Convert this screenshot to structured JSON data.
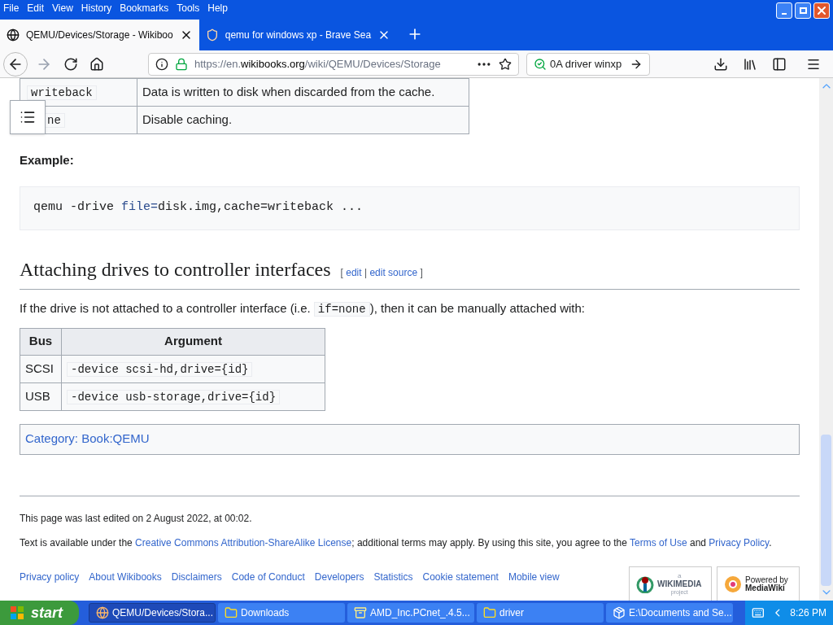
{
  "menu": [
    "File",
    "Edit",
    "View",
    "History",
    "Bookmarks",
    "Tools",
    "Help"
  ],
  "tabs": [
    {
      "label": "QEMU/Devices/Storage - Wikiboo",
      "selected": true
    },
    {
      "label": "qemu for windows xp - Brave Sea",
      "selected": false
    }
  ],
  "address": {
    "prefix": "https://en.",
    "domain": "wikibooks.org",
    "path": "/wiki/QEMU/Devices/Storage"
  },
  "search": {
    "value": "0A driver winxp"
  },
  "cache_table": {
    "rows": [
      {
        "mode": "writeback",
        "description": "Data is written to disk when discarded from the cache."
      },
      {
        "mode": "ne",
        "description": "Disable caching."
      }
    ]
  },
  "example_label": "Example:",
  "code_block": [
    {
      "text": "qemu -drive ",
      "kind": "plain"
    },
    {
      "text": "file=",
      "kind": "keyword"
    },
    {
      "text": "disk.img,cache=writeback ...",
      "kind": "plain"
    }
  ],
  "heading": {
    "title": "Attaching drives to controller interfaces",
    "open": "[",
    "links": [
      "edit",
      "edit source"
    ],
    "separator": "|",
    "close": "]"
  },
  "intro": [
    {
      "text": "If the drive is not attached to a controller interface (i.e. ",
      "kind": "text"
    },
    {
      "text": "if=none",
      "kind": "code"
    },
    {
      "text": "), then it can be manually attached with:",
      "kind": "text"
    }
  ],
  "bus_table": {
    "columns": [
      "Bus",
      "Argument"
    ],
    "rows": [
      {
        "bus": "SCSI",
        "argument": "-device scsi-hd,drive={id}"
      },
      {
        "bus": "USB",
        "argument": "-device usb-storage,drive={id}"
      }
    ]
  },
  "category": "Category: Book:QEMU",
  "footer": {
    "last_edited": "This page was last edited on 2 August 2022, at 00:02.",
    "license": [
      {
        "text": "Text is available under the ",
        "kind": "text"
      },
      {
        "text": "Creative Commons Attribution-ShareAlike License",
        "kind": "link"
      },
      {
        "text": "; additional terms may apply. By using this site, you agree to the ",
        "kind": "text"
      },
      {
        "text": "Terms of Use",
        "kind": "link"
      },
      {
        "text": " and ",
        "kind": "text"
      },
      {
        "text": "Privacy Policy",
        "kind": "link"
      },
      {
        "text": ".",
        "kind": "text"
      }
    ],
    "links": [
      "Privacy policy",
      "About Wikibooks",
      "Disclaimers",
      "Code of Conduct",
      "Developers",
      "Statistics",
      "Cookie statement",
      "Mobile view"
    ],
    "badges": [
      {
        "small": "a",
        "big": "WIKIMEDIA",
        "sub": "project"
      },
      {
        "small": "Powered by",
        "big": "MediaWiki"
      }
    ]
  },
  "taskbar": {
    "start": "start",
    "tasks": [
      {
        "label": "QEMU/Devices/Stora...",
        "selected": true,
        "kind": "browser"
      },
      {
        "label": "Downloads",
        "selected": false,
        "kind": "folder"
      },
      {
        "label": "AMD_Inc.PCnet_.4.5...",
        "selected": false,
        "kind": "archive"
      },
      {
        "label": "driver",
        "selected": false,
        "kind": "folder"
      },
      {
        "label": "E:\\Documents and Se...",
        "selected": false,
        "kind": "zip"
      }
    ],
    "time": "8:26 PM"
  }
}
